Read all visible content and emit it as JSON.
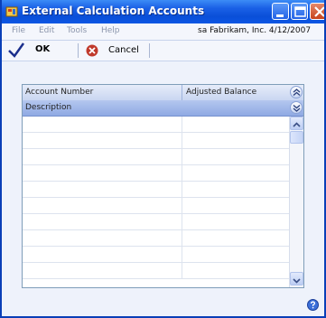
{
  "window": {
    "title": "External Calculation Accounts"
  },
  "menubar": {
    "items": [
      "File",
      "Edit",
      "Tools",
      "Help"
    ],
    "company_info": "sa  Fabrikam, Inc.  4/12/2007"
  },
  "toolbar": {
    "ok_label": "OK",
    "cancel_label": "Cancel"
  },
  "grid": {
    "headers": {
      "account_number": "Account Number",
      "adjusted_balance": "Adjusted Balance",
      "description": "Description"
    }
  },
  "colors": {
    "title_bar": "#0a4fd8",
    "header_row2": "#8fa9e3",
    "ok_check": "#1b2f8c",
    "cancel_icon": "#c0392b"
  },
  "icons": [
    "app-icon",
    "minimize-icon",
    "maximize-icon",
    "close-icon",
    "checkmark-icon",
    "cancel-icon",
    "collapse-icon",
    "expand-icon",
    "scroll-up-icon",
    "scroll-down-icon",
    "help-icon"
  ]
}
